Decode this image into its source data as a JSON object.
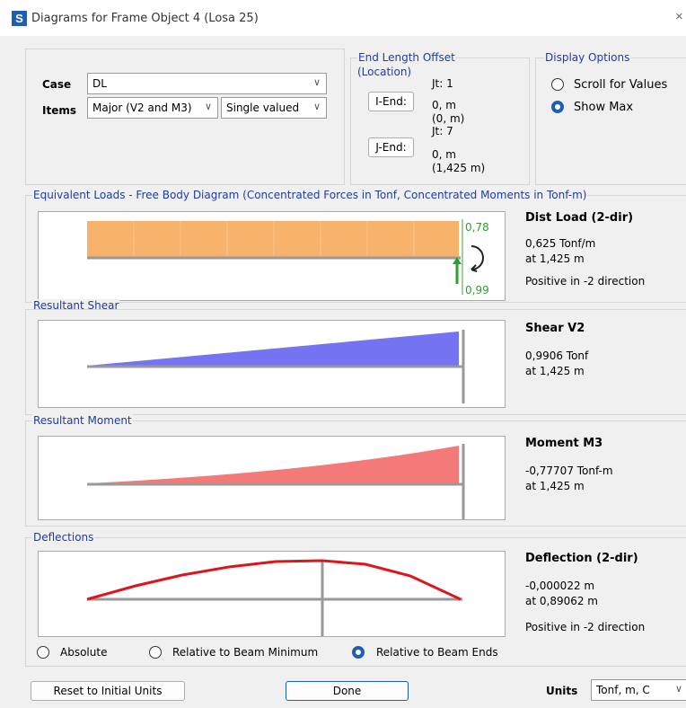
{
  "window": {
    "icon_letter": "S",
    "title": "Diagrams for Frame Object 4  (Losa 25)",
    "close_glyph": "×"
  },
  "case": {
    "label": "Case",
    "value": "DL"
  },
  "items": {
    "label": "Items",
    "component": "Major (V2 and M3)",
    "mode": "Single valued"
  },
  "end_length_offset": {
    "title": "End Length Offset",
    "location": "(Location)",
    "i_end": {
      "button": "I-End:",
      "jt": "Jt:  1",
      "value": "0, m",
      "location": "(0, m)"
    },
    "j_end": {
      "button": "J-End:",
      "jt": "Jt:  7",
      "value": "0, m",
      "location": "(1,425 m)"
    }
  },
  "display_options": {
    "title": "Display Options",
    "options": [
      "Scroll for Values",
      "Show Max"
    ],
    "selected": "Show Max"
  },
  "free_body": {
    "title": "Equivalent Loads - Free Body Diagram  (Concentrated Forces in Tonf, Concentrated Moments in Tonf-m)",
    "moment_label": "0,78",
    "force_label": "0,99",
    "heading": "Dist Load (2-dir)",
    "value": "0,625 Tonf/m",
    "at": "at 1,425 m",
    "note": "Positive in -2 direction",
    "fill_color": "#f7b26b"
  },
  "shear": {
    "title": "Resultant Shear",
    "heading": "Shear V2",
    "value": "0,9906 Tonf",
    "at": "at 1,425 m",
    "fill_color": "#7474f2"
  },
  "moment": {
    "title": "Resultant Moment",
    "heading": "Moment M3",
    "value": "-0,77707 Tonf-m",
    "at": "at 1,425 m",
    "fill_color": "#f47979"
  },
  "deflection": {
    "title": "Deflections",
    "heading": "Deflection (2-dir)",
    "value": "-0,000022 m",
    "at": "at 0,89062 m",
    "note": "Positive in -2 direction",
    "line_color": "#e0141b",
    "options": [
      "Absolute",
      "Relative to Beam Minimum",
      "Relative to Beam Ends"
    ],
    "selected": "Relative to Beam Ends"
  },
  "footer": {
    "reset_button": "Reset to Initial Units",
    "done_button": "Done",
    "units_label": "Units",
    "units_value": "Tonf, m, C"
  }
}
